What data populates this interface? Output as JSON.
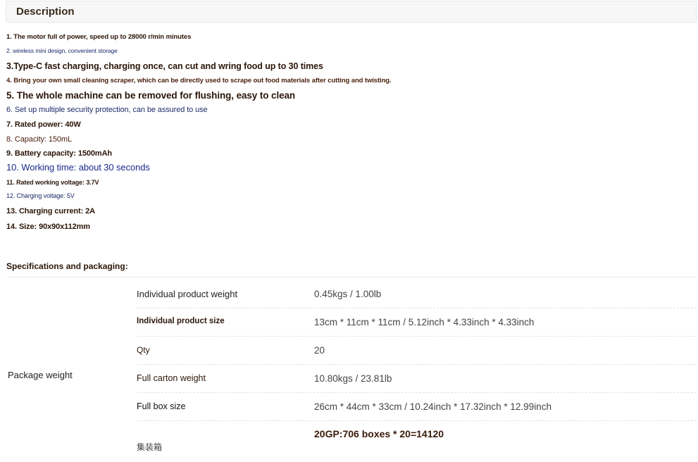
{
  "description": {
    "title": "Description",
    "features": [
      "1. The motor full of power, speed up to 28000 r/min minutes",
      "2. wireless mini design, convenient storage",
      "3.Type-C fast charging, charging once, can cut and wring food up to 30 times",
      "4. Bring your own small cleaning scraper, which can be directly used to scrape out food materials after cutting and twisting.",
      "5. The whole machine can be removed for flushing, easy to clean",
      "6. Set up multiple security protection, can be assured to use",
      "7. Rated power: 40W",
      "8. Capacity: 150mL",
      "9. Battery capacity: 1500mAh",
      "10. Working time: about 30 seconds",
      "11. Rated working voltage: 3.7V",
      "12. Charging voltage: 5V",
      "13. Charging current: 2A",
      "14. Size: 90x90x112mm"
    ]
  },
  "specs": {
    "title": "Specifications and packaging:",
    "group_label": "Package weight",
    "rows": [
      {
        "label": "Individual product weight",
        "value": "0.45kgs / 1.00lb"
      },
      {
        "label": "Individual product size",
        "value": "13cm * 11cm * 11cm / 5.12inch * 4.33inch * 4.33inch"
      },
      {
        "label": "Qty",
        "value": "20"
      },
      {
        "label": "Full carton weight",
        "value": "10.80kgs / 23.81lb"
      },
      {
        "label": "Full box size",
        "value": "26cm * 44cm * 33cm / 10.24inch * 17.32inch * 12.99inch"
      },
      {
        "label": "集装箱",
        "value": "20GP:706 boxes * 20=14120"
      }
    ]
  }
}
